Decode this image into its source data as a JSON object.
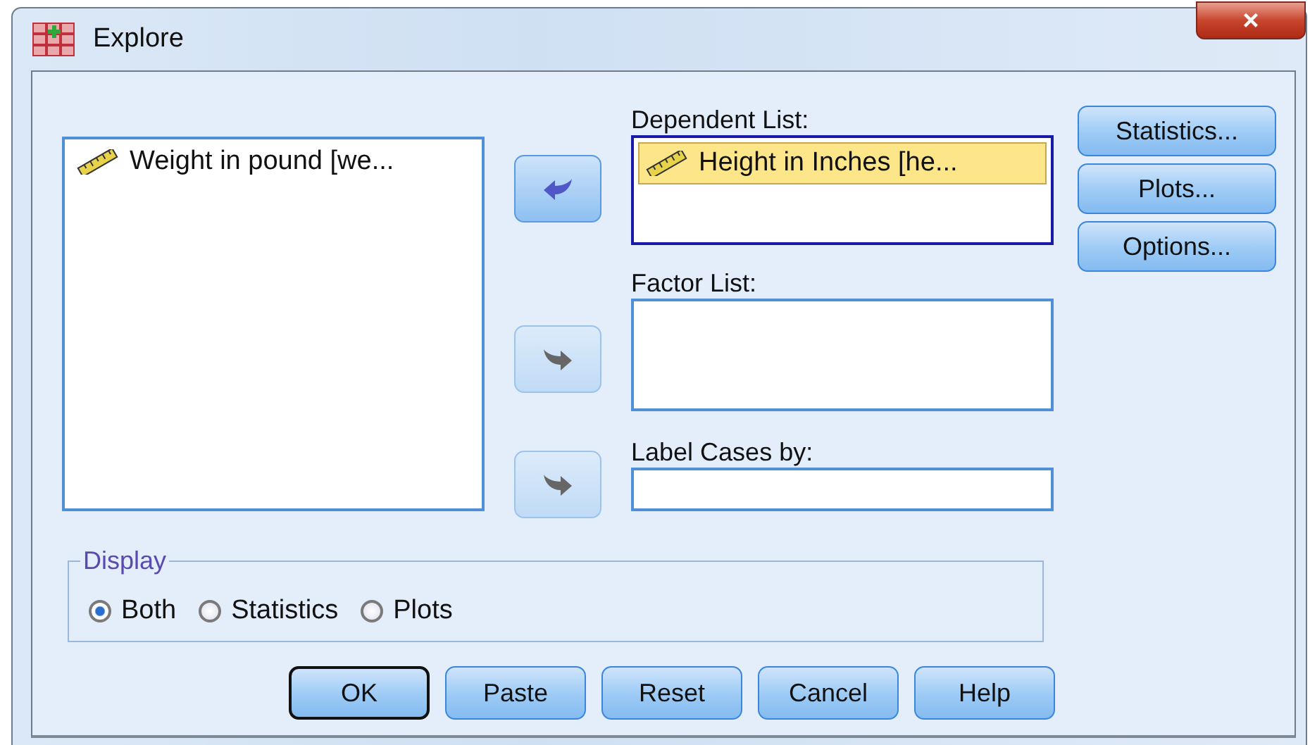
{
  "window": {
    "title": "Explore",
    "close": "×"
  },
  "variables": [
    {
      "label": "Weight in pound [we...",
      "selected": false
    }
  ],
  "arrow_buttons": [
    {
      "kind": "left",
      "disabled": false
    },
    {
      "kind": "right",
      "disabled": true
    },
    {
      "kind": "right",
      "disabled": true
    }
  ],
  "dependent_list": {
    "label": "Dependent List:",
    "items": [
      {
        "label": "Height in Inches [he...",
        "selected": true
      }
    ]
  },
  "factor_list": {
    "label": "Factor List:"
  },
  "label_cases": {
    "label": "Label Cases by:"
  },
  "side_buttons": [
    {
      "label": "Statistics..."
    },
    {
      "label": "Plots..."
    },
    {
      "label": "Options..."
    }
  ],
  "display": {
    "title": "Display",
    "options": [
      {
        "label": "Both",
        "selected": true
      },
      {
        "label": "Statistics",
        "selected": false
      },
      {
        "label": "Plots",
        "selected": false
      }
    ]
  },
  "buttons": [
    {
      "label": "OK",
      "default": true
    },
    {
      "label": "Paste",
      "default": false
    },
    {
      "label": "Reset",
      "default": false
    },
    {
      "label": "Cancel",
      "default": false
    },
    {
      "label": "Help",
      "default": false
    }
  ]
}
